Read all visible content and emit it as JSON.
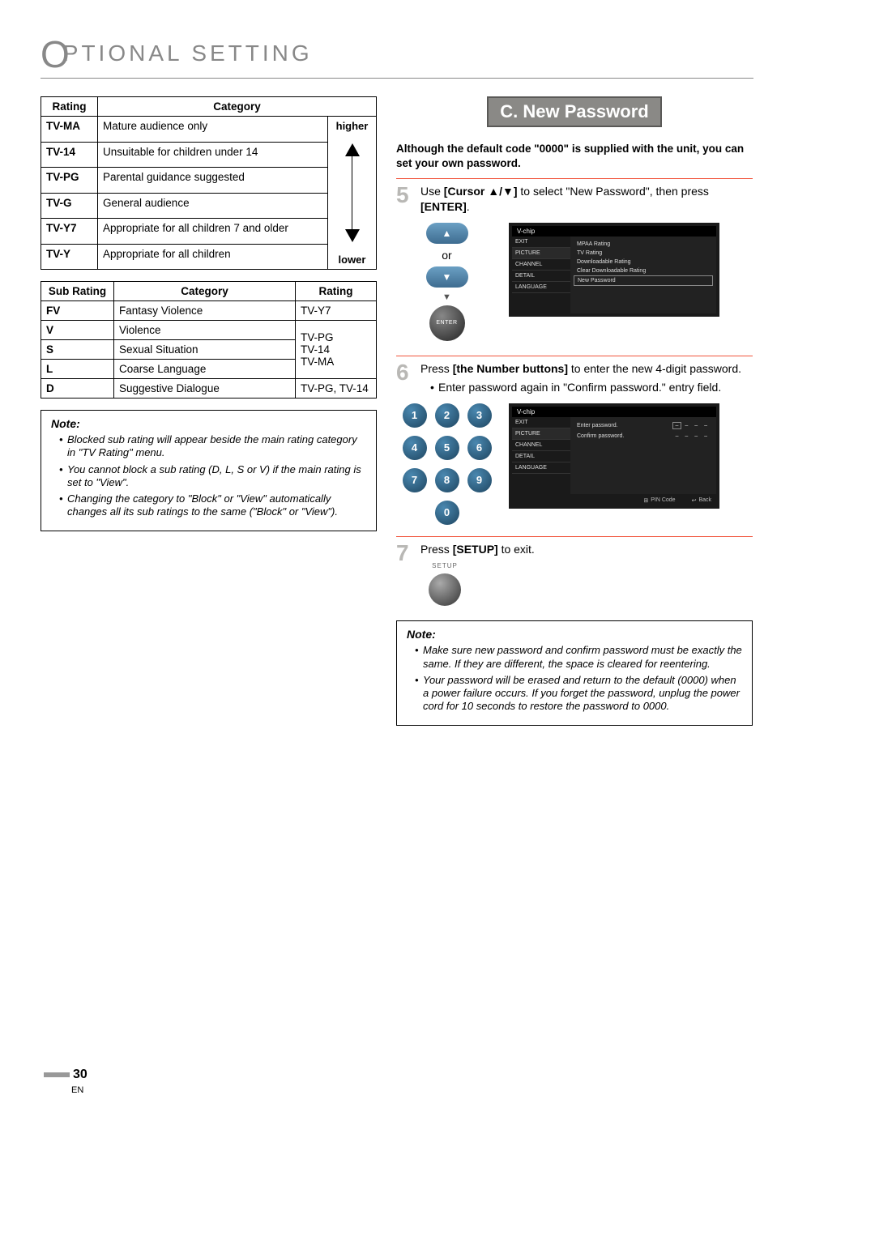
{
  "header": {
    "titlePrefix": "O",
    "titleRest": "PTIONAL  SETTING"
  },
  "ratingsTable": {
    "headers": {
      "rating": "Rating",
      "category": "Category"
    },
    "rows": [
      {
        "rating": "TV-MA",
        "category": "Mature audience only"
      },
      {
        "rating": "TV-14",
        "category": "Unsuitable for children under 14"
      },
      {
        "rating": "TV-PG",
        "category": "Parental guidance suggested"
      },
      {
        "rating": "TV-G",
        "category": "General audience"
      },
      {
        "rating": "TV-Y7",
        "category": "Appropriate for all children 7 and older"
      },
      {
        "rating": "TV-Y",
        "category": "Appropriate for all children"
      }
    ],
    "higher": "higher",
    "lower": "lower"
  },
  "subRatingsTable": {
    "headers": {
      "sub": "Sub Rating",
      "category": "Category",
      "rating": "Rating"
    },
    "rows": [
      {
        "sub": "FV",
        "category": "Fantasy Violence",
        "rating": "TV-Y7"
      },
      {
        "sub": "V",
        "category": "Violence",
        "rating_combined_start": true
      },
      {
        "sub": "S",
        "category": "Sexual Situation"
      },
      {
        "sub": "L",
        "category": "Coarse Language"
      },
      {
        "sub": "D",
        "category": "Suggestive Dialogue",
        "rating": "TV-PG, TV-14"
      }
    ],
    "combinedRatingText": "TV-PG\nTV-14\nTV-MA"
  },
  "note1": {
    "title": "Note:",
    "items": [
      "Blocked sub rating will appear beside the main rating category in \"TV Rating\" menu.",
      "You cannot block a sub rating (D, L, S or V) if the main rating is set to \"View\".",
      "Changing the category to \"Block\" or \"View\" automatically changes all its sub ratings to the same (\"Block\" or \"View\")."
    ]
  },
  "sectionC": {
    "header": "C.  New Password",
    "intro": "Although the default code \"0000\" is supplied with the unit, you can set your own password."
  },
  "step5": {
    "num": "5",
    "textParts": {
      "a": "Use ",
      "b": "[Cursor ▲/▼]",
      "c": " to select \"New Password\", then press ",
      "d": "[ENTER]",
      "e": "."
    },
    "or": "or",
    "enterLabel": "ENTER",
    "tv": {
      "title": "V-chip",
      "left": [
        "EXIT",
        "PICTURE",
        "CHANNEL",
        "DETAIL",
        "LANGUAGE"
      ],
      "opts": [
        "MPAA Rating",
        "TV Rating",
        "Downloadable Rating",
        "Clear Downloadable Rating",
        "New Password"
      ]
    }
  },
  "step6": {
    "num": "6",
    "textParts": {
      "a": "Press ",
      "b": "[the Number buttons]",
      "c": " to enter the new 4-digit password."
    },
    "bullet": "Enter password again in \"Confirm password.\" entry field.",
    "keys": [
      "1",
      "2",
      "3",
      "4",
      "5",
      "6",
      "7",
      "8",
      "9",
      "0"
    ],
    "tv": {
      "title": "V-chip",
      "left": [
        "EXIT",
        "PICTURE",
        "CHANNEL",
        "DETAIL",
        "LANGUAGE"
      ],
      "enter": "Enter password.",
      "confirm": "Confirm password.",
      "dashes": "– – – –",
      "pin": "PIN Code",
      "back": "Back"
    }
  },
  "step7": {
    "num": "7",
    "textParts": {
      "a": "Press ",
      "b": "[SETUP]",
      "c": " to exit."
    },
    "setupLabel": "SETUP"
  },
  "note2": {
    "title": "Note:",
    "items": [
      "Make sure new password and confirm password must be exactly the same. If they are different, the space is cleared for reentering.",
      "Your password will be erased and return to the default (0000) when a power failure occurs. If you forget the password, unplug the power cord for 10 seconds to restore the password to 0000."
    ]
  },
  "pageNumber": "30",
  "langLabel": "EN"
}
